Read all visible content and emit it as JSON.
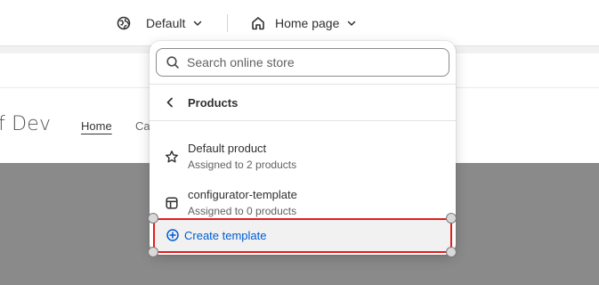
{
  "topbar": {
    "theme_label": "Default",
    "page_label": "Home page"
  },
  "preview": {
    "store_name": "f Dev",
    "nav_home": "Home",
    "nav_catalog_partial": "Ca"
  },
  "dropdown": {
    "search_placeholder": "Search online store",
    "back_label": "Products",
    "templates": [
      {
        "name": "Default product",
        "subtitle": "Assigned to 2 products",
        "icon": "star-icon"
      },
      {
        "name": "configurator-template",
        "subtitle": "Assigned to 0 products",
        "icon": "layout-icon"
      }
    ],
    "create_label": "Create template"
  },
  "colors": {
    "accent_link": "#005bd3",
    "selection_outline": "#e11d1d",
    "hero_background": "#8a8a8a"
  }
}
